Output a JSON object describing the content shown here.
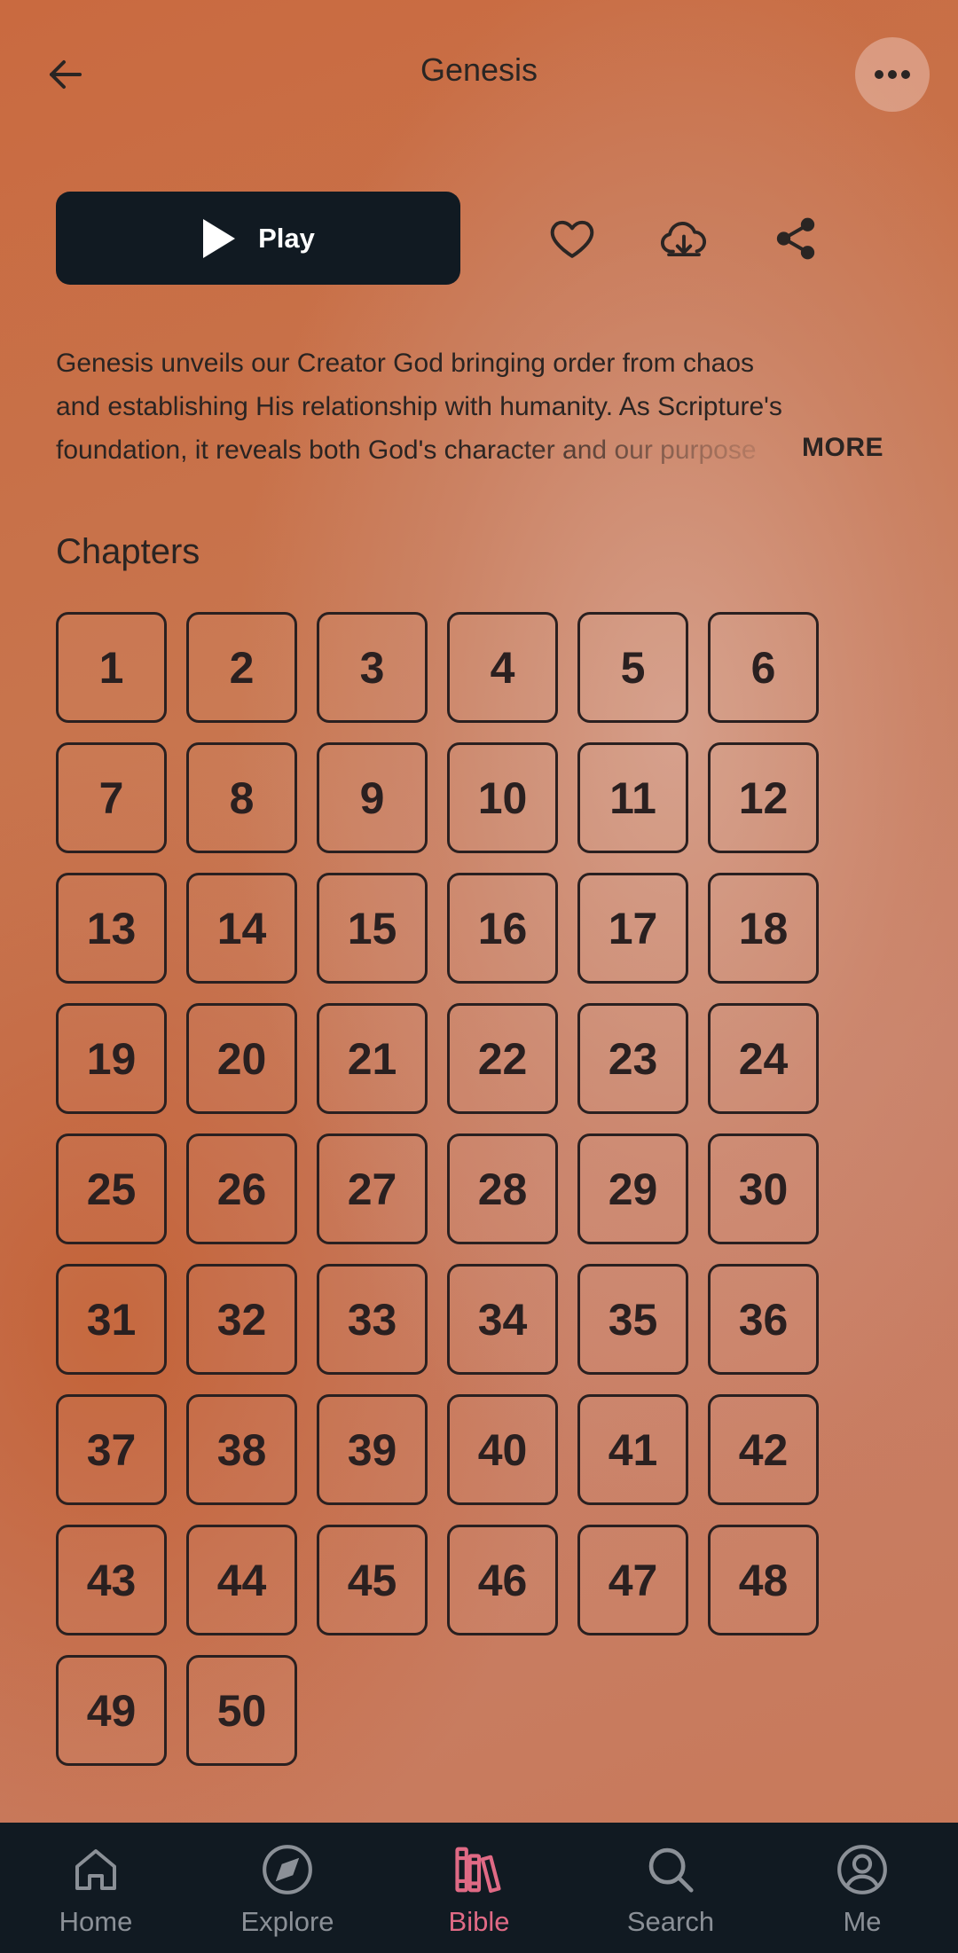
{
  "header": {
    "title": "Genesis",
    "back_icon": "arrow-left-icon",
    "menu_icon": "more-horizontal-icon"
  },
  "actions": {
    "play_label": "Play",
    "favorite_icon": "heart-icon",
    "download_icon": "cloud-download-icon",
    "share_icon": "share-icon"
  },
  "description": {
    "text": "Genesis unveils our Creator God bringing order from chaos and establishing His relationship with humanity. As Scripture's foundation, it reveals both God's character and our purpose",
    "more_label": "MORE"
  },
  "chapters": {
    "heading": "Chapters",
    "items": [
      "1",
      "2",
      "3",
      "4",
      "5",
      "6",
      "7",
      "8",
      "9",
      "10",
      "11",
      "12",
      "13",
      "14",
      "15",
      "16",
      "17",
      "18",
      "19",
      "20",
      "21",
      "22",
      "23",
      "24",
      "25",
      "26",
      "27",
      "28",
      "29",
      "30",
      "31",
      "32",
      "33",
      "34",
      "35",
      "36",
      "37",
      "38",
      "39",
      "40",
      "41",
      "42",
      "43",
      "44",
      "45",
      "46",
      "47",
      "48",
      "49",
      "50"
    ]
  },
  "bottom_nav": {
    "items": [
      {
        "label": "Home",
        "icon": "home-icon",
        "active": false
      },
      {
        "label": "Explore",
        "icon": "compass-icon",
        "active": false
      },
      {
        "label": "Bible",
        "icon": "books-icon",
        "active": true
      },
      {
        "label": "Search",
        "icon": "search-icon",
        "active": false
      },
      {
        "label": "Me",
        "icon": "user-circle-icon",
        "active": false
      }
    ]
  },
  "colors": {
    "nav_background": "#111a22",
    "active_accent": "#e06a85",
    "inactive_nav": "#8b9097",
    "play_button": "#111a22"
  }
}
